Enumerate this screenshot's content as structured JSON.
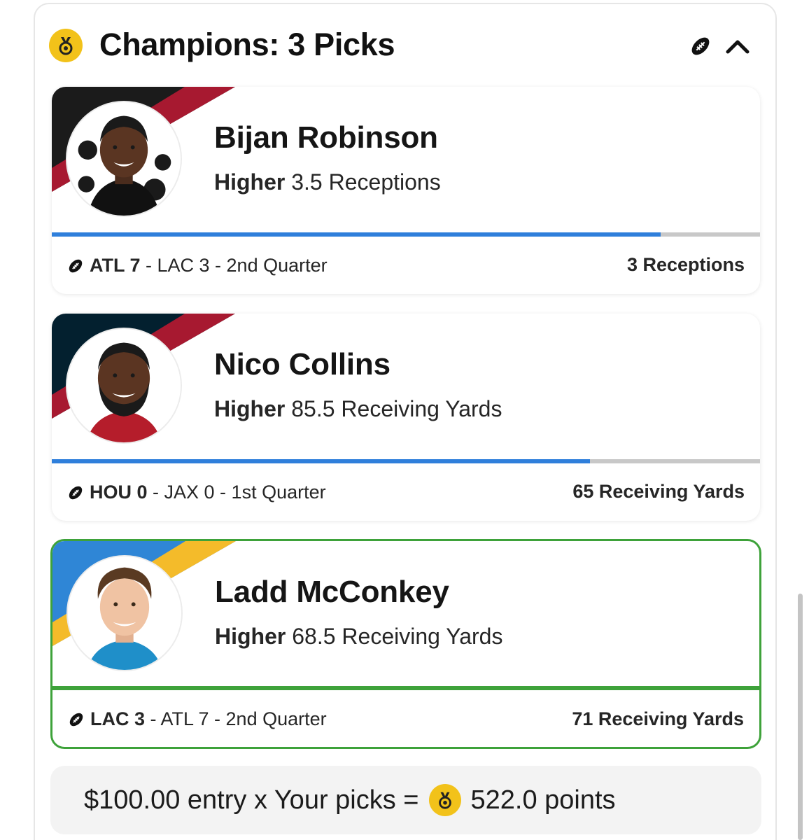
{
  "header": {
    "title": "Champions: 3 Picks",
    "medal_icon": "medal-icon",
    "sport_icon": "football-icon",
    "collapse_icon": "chevron-up-icon"
  },
  "colors": {
    "accent_blue": "#2f7fdb",
    "win_green": "#3ea23a",
    "medal_gold": "#f2c21a"
  },
  "picks": [
    {
      "player": "Bijan Robinson",
      "direction": "Higher",
      "line": "3.5 Receptions",
      "progress": 0.86,
      "team_colors": [
        "#1b1b1b",
        "#a71930"
      ],
      "game": {
        "lead": "ATL 7",
        "rest": " - LAC 3 - 2nd Quarter"
      },
      "stat": "3 Receptions",
      "status": "in-progress"
    },
    {
      "player": "Nico Collins",
      "direction": "Higher",
      "line": "85.5 Receiving Yards",
      "progress": 0.76,
      "team_colors": [
        "#03202f",
        "#a71930"
      ],
      "game": {
        "lead": "HOU 0",
        "rest": " - JAX 0 - 1st Quarter"
      },
      "stat": "65 Receiving Yards",
      "status": "in-progress"
    },
    {
      "player": "Ladd McConkey",
      "direction": "Higher",
      "line": "68.5 Receiving Yards",
      "progress": 1.0,
      "team_colors": [
        "#2f86d6",
        "#f4bb2a"
      ],
      "game": {
        "lead": "LAC 3",
        "rest": " - ATL 7 - 2nd Quarter"
      },
      "stat": "71 Receiving Yards",
      "status": "hit"
    }
  ],
  "summary": {
    "prefix": "$100.00 entry x Your picks =",
    "points": "522.0 points"
  }
}
